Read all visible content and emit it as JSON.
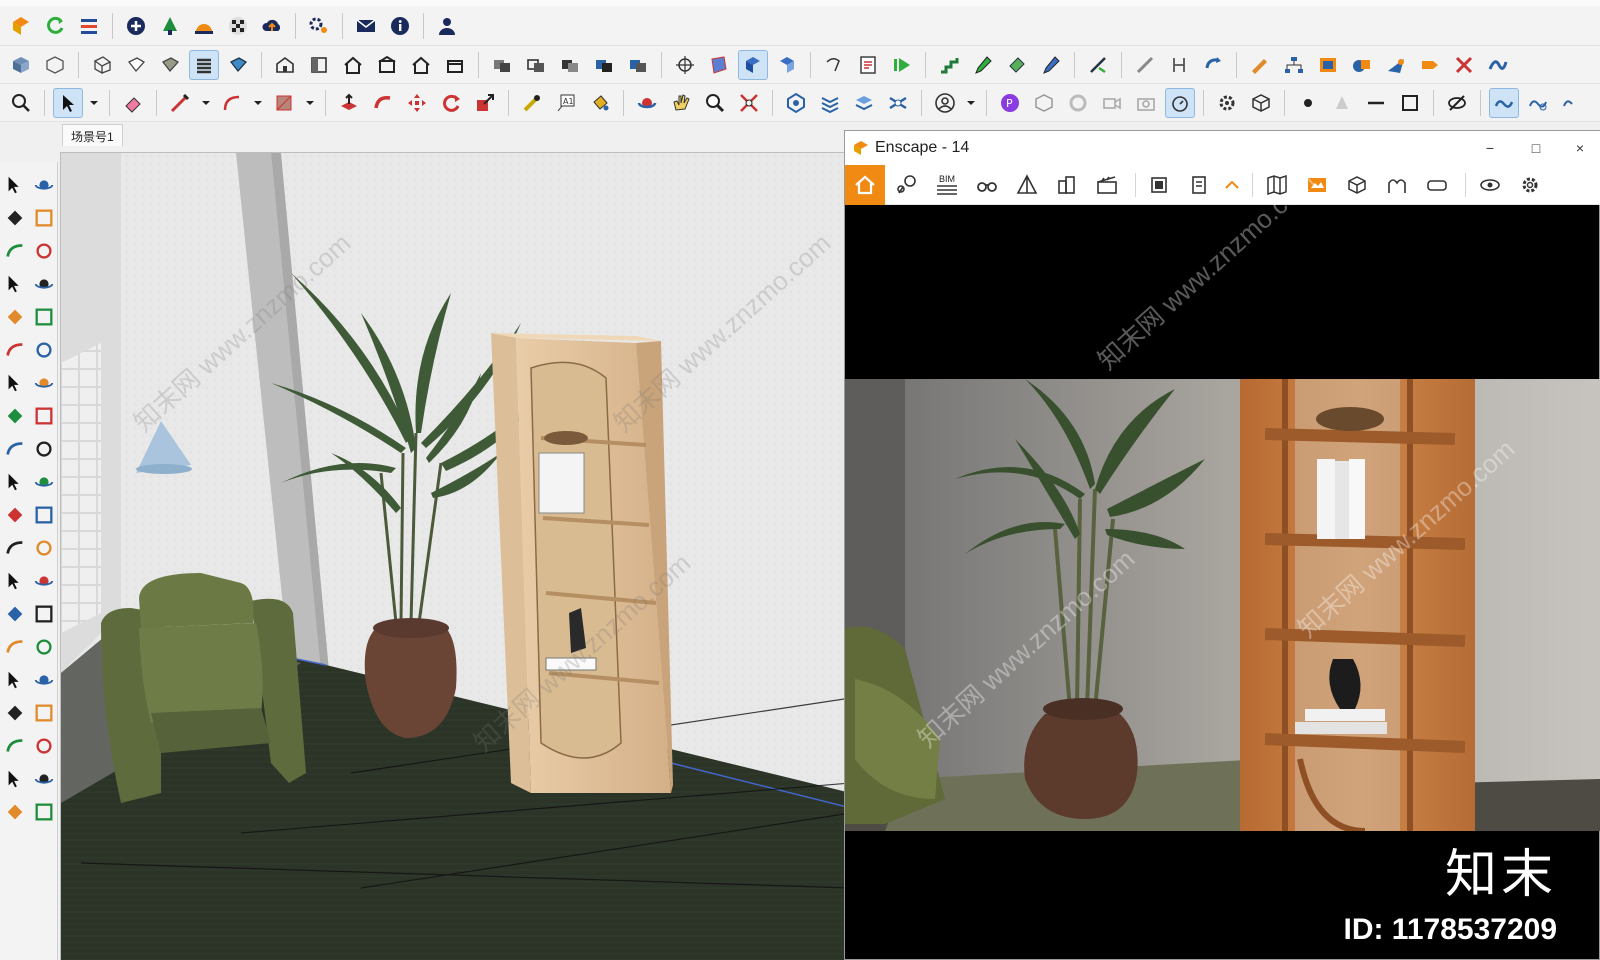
{
  "scene": {
    "tab_label": "场景号1"
  },
  "enscape": {
    "title": "Enscape - 14",
    "bim_label": "BIM",
    "window_controls": {
      "minimize": "−",
      "maximize": "□",
      "close": "×"
    }
  },
  "watermark": {
    "brand": "知末",
    "id": "ID: 1178537209",
    "diagonal": "知末网 www.znzmo.com"
  },
  "colors": {
    "enscape_accent": "#f18a12",
    "sketchup_active_blue": "#cfe3f7",
    "wall": "#e6e6e6",
    "floor": "#2b3326",
    "shelf_wood": "#e2c39e",
    "chair_green": "#5e6b3d"
  },
  "toolbar_icons": [
    "enscape-logo-icon",
    "refresh-icon",
    "align-icon",
    "add-circle-icon",
    "tree-icon",
    "sun-icon",
    "checker-icon",
    "cloud-upload-icon",
    "gears-icon",
    "mail-icon",
    "info-icon",
    "user-icon"
  ],
  "palette_icons": [
    "select-icon",
    "orbit-icon",
    "paint-bucket-icon",
    "eraser-icon",
    "component-icon",
    "tape-icon",
    "line-icon",
    "freehand-icon",
    "rectangle-icon",
    "rotated-rect-icon",
    "circle-icon",
    "polygon-icon",
    "arc-icon",
    "arc2-icon",
    "pie-icon",
    "arc3-icon",
    "move-icon",
    "push-pull-icon",
    "rotate-icon",
    "follow-me-icon",
    "scale-icon",
    "offset-icon",
    "tape-measure-icon",
    "protractor-icon",
    "axes-icon",
    "text-icon",
    "paint-icon",
    "pan-icon",
    "zoom-icon",
    "zoom-window-icon",
    "zoom-extents-icon",
    "section-icon",
    "walk-icon",
    "look-icon",
    "position-camera-icon",
    "dimension-icon",
    "sandbox-icon",
    "stamp-icon",
    "drape-icon",
    "flip-icon"
  ]
}
